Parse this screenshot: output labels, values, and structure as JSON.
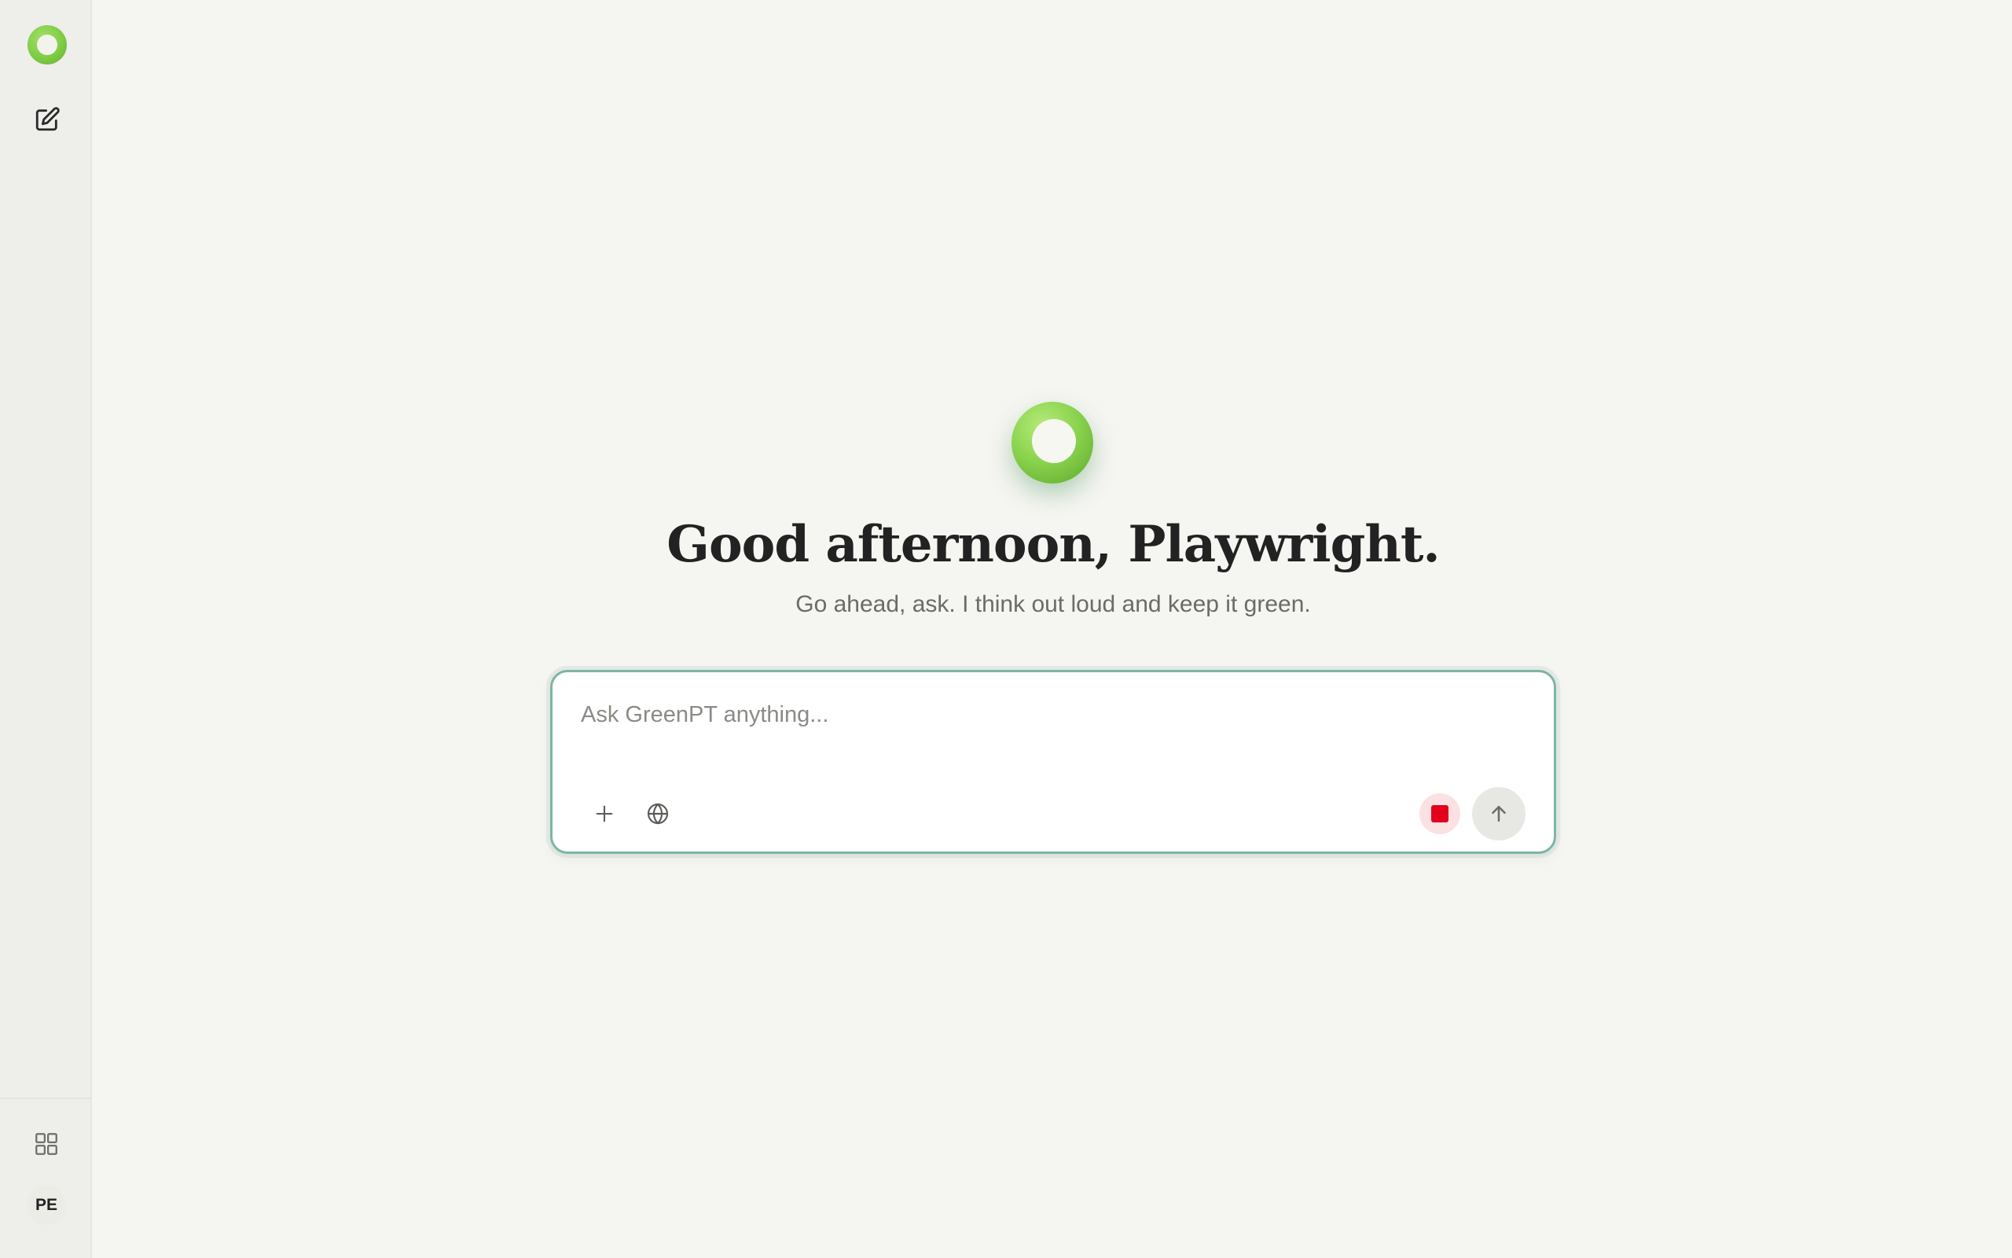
{
  "sidebar": {
    "logo_icon": "greenpt-ring-logo-icon",
    "new_chat_icon": "edit-pencil-square-icon",
    "apps_icon": "grid-apps-icon",
    "avatar_initials": "PE"
  },
  "main": {
    "hero_icon": "greenpt-ring-logo-icon",
    "greeting": "Good afternoon, Playwright.",
    "subtitle": "Go ahead, ask. I think out loud and keep it green."
  },
  "composer": {
    "placeholder": "Ask GreenPT anything...",
    "value": "",
    "add_icon": "plus-icon",
    "web_icon": "globe-icon",
    "record_icon": "stop-square-icon",
    "send_icon": "arrow-up-icon"
  },
  "colors": {
    "background": "#f5f5f1",
    "sidebar": "#eeeeea",
    "brand_green": "#8bd44e",
    "composer_border": "#7fb3a6",
    "stop_red": "#e3001b"
  }
}
